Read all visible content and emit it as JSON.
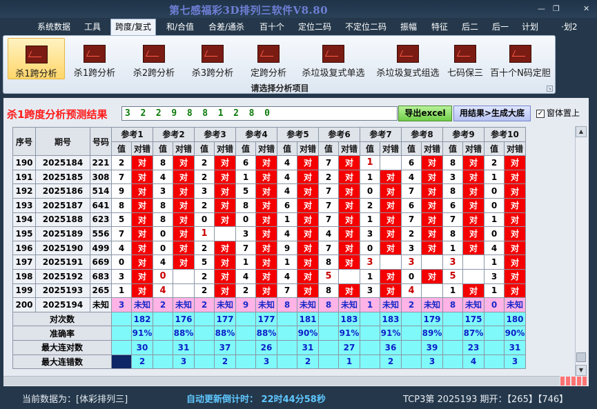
{
  "window": {
    "title": "第七感福彩3D排列三软件V8.80",
    "buttons": {
      "minimize": "—",
      "restore": "❐",
      "close": "✕"
    }
  },
  "menu": {
    "items": [
      "系统数据",
      "工具",
      "跨度/复式",
      "和/合值",
      "合差/通杀",
      "百十个",
      "定位二码",
      "不定位二码",
      "振幅",
      "特征",
      "后二",
      "后一",
      "计划",
      "·划2"
    ],
    "active_index": 2
  },
  "ribbon": {
    "buttons": [
      "杀1跨分析",
      "杀1跨分析",
      "杀2跨分析",
      "杀3跨分析",
      "定跨分析",
      "杀垃圾复式单选",
      "杀垃圾复式组选",
      "七码保三",
      "百十个N码定胆"
    ],
    "selected_index": 0,
    "caption": "请选择分析项目"
  },
  "result": {
    "title": "杀1跨度分析预测结果",
    "value": "3 2 2 9 8 8 1 2 8 0",
    "export_label": "导出excel",
    "generate_label": "用结果>生成大底",
    "topmost_label": "窗体置上",
    "topmost_checked": true
  },
  "table": {
    "headers": {
      "index": "序号",
      "period": "期号",
      "number": "号码",
      "value": "值",
      "hit": "对错"
    },
    "groups": [
      "参考1",
      "参考2",
      "参考3",
      "参考4",
      "参考5",
      "参考6",
      "参考7",
      "参考8",
      "参考9",
      "参考10"
    ],
    "hit_text": "对",
    "rows": [
      {
        "idx": "190",
        "period": "2025184",
        "num": "221",
        "vals": [
          "2",
          "8",
          "2",
          "6",
          "4",
          "7",
          "1",
          "6",
          "8",
          "2"
        ],
        "hits": [
          1,
          1,
          1,
          1,
          1,
          1,
          0,
          1,
          1,
          1
        ]
      },
      {
        "idx": "191",
        "period": "2025185",
        "num": "308",
        "vals": [
          "7",
          "4",
          "2",
          "1",
          "4",
          "2",
          "1",
          "4",
          "3",
          "1"
        ],
        "hits": [
          1,
          1,
          1,
          1,
          1,
          1,
          1,
          1,
          1,
          1
        ]
      },
      {
        "idx": "192",
        "period": "2025186",
        "num": "514",
        "vals": [
          "9",
          "3",
          "3",
          "5",
          "4",
          "7",
          "0",
          "7",
          "8",
          "0"
        ],
        "hits": [
          1,
          1,
          1,
          1,
          1,
          1,
          1,
          1,
          1,
          1
        ]
      },
      {
        "idx": "193",
        "period": "2025187",
        "num": "641",
        "vals": [
          "8",
          "8",
          "2",
          "8",
          "6",
          "7",
          "2",
          "6",
          "6",
          "0"
        ],
        "hits": [
          1,
          1,
          1,
          1,
          1,
          1,
          1,
          1,
          1,
          1
        ]
      },
      {
        "idx": "194",
        "period": "2025188",
        "num": "623",
        "vals": [
          "5",
          "8",
          "0",
          "0",
          "1",
          "7",
          "1",
          "7",
          "7",
          "1"
        ],
        "hits": [
          1,
          1,
          1,
          1,
          1,
          1,
          1,
          1,
          1,
          1
        ]
      },
      {
        "idx": "195",
        "period": "2025189",
        "num": "556",
        "vals": [
          "7",
          "0",
          "1",
          "3",
          "4",
          "4",
          "3",
          "2",
          "8",
          "0"
        ],
        "hits": [
          1,
          1,
          0,
          1,
          1,
          1,
          1,
          1,
          1,
          1
        ]
      },
      {
        "idx": "196",
        "period": "2025190",
        "num": "499",
        "vals": [
          "4",
          "0",
          "2",
          "7",
          "9",
          "7",
          "0",
          "3",
          "1",
          "4"
        ],
        "hits": [
          1,
          1,
          1,
          1,
          1,
          1,
          1,
          1,
          1,
          1
        ]
      },
      {
        "idx": "197",
        "period": "2025191",
        "num": "669",
        "vals": [
          "0",
          "4",
          "5",
          "1",
          "1",
          "8",
          "3",
          "3",
          "3",
          "1"
        ],
        "hits": [
          1,
          1,
          1,
          1,
          1,
          1,
          0,
          0,
          0,
          1
        ]
      },
      {
        "idx": "198",
        "period": "2025192",
        "num": "683",
        "vals": [
          "3",
          "0",
          "2",
          "4",
          "4",
          "5",
          "1",
          "0",
          "5",
          "3"
        ],
        "hits": [
          1,
          0,
          1,
          1,
          1,
          0,
          1,
          1,
          0,
          1
        ]
      },
      {
        "idx": "199",
        "period": "2025193",
        "num": "265",
        "vals": [
          "1",
          "4",
          "2",
          "2",
          "7",
          "8",
          "3",
          "4",
          "1",
          "1"
        ],
        "hits": [
          1,
          0,
          1,
          1,
          1,
          1,
          1,
          0,
          1,
          1
        ]
      }
    ],
    "pending_row": {
      "idx": "200",
      "period": "2025194",
      "num": "未知",
      "vals": [
        "3",
        "2",
        "2",
        "9",
        "8",
        "8",
        "1",
        "2",
        "8",
        "0"
      ],
      "hit_text": "未知"
    },
    "stats": [
      {
        "label": "对次数",
        "values": [
          "182",
          "176",
          "177",
          "177",
          "181",
          "183",
          "183",
          "179",
          "175",
          "180"
        ]
      },
      {
        "label": "准确率",
        "values": [
          "91%",
          "88%",
          "88%",
          "88%",
          "90%",
          "91%",
          "91%",
          "89%",
          "87%",
          "90%"
        ]
      },
      {
        "label": "最大连对数",
        "values": [
          "30",
          "31",
          "37",
          "26",
          "31",
          "27",
          "36",
          "39",
          "23",
          "31"
        ]
      },
      {
        "label": "最大连错数",
        "values": [
          "2",
          "3",
          "2",
          "3",
          "2",
          "1",
          "2",
          "3",
          "4",
          "3"
        ]
      }
    ]
  },
  "status": {
    "current_data": "当前数据为：[体彩排列三]",
    "countdown_label": "自动更新倒计时：",
    "countdown_value": "22时44分58秒",
    "latest": "TCP3第 2025193 期开：【265】【746】"
  },
  "colors": {
    "hit_red": "#f50000",
    "stat_cyan": "#7ff9f9",
    "pending_pink": "#ffb3e6",
    "title_red": "#ff1a1a",
    "title_blue": "#6f7fd6"
  }
}
